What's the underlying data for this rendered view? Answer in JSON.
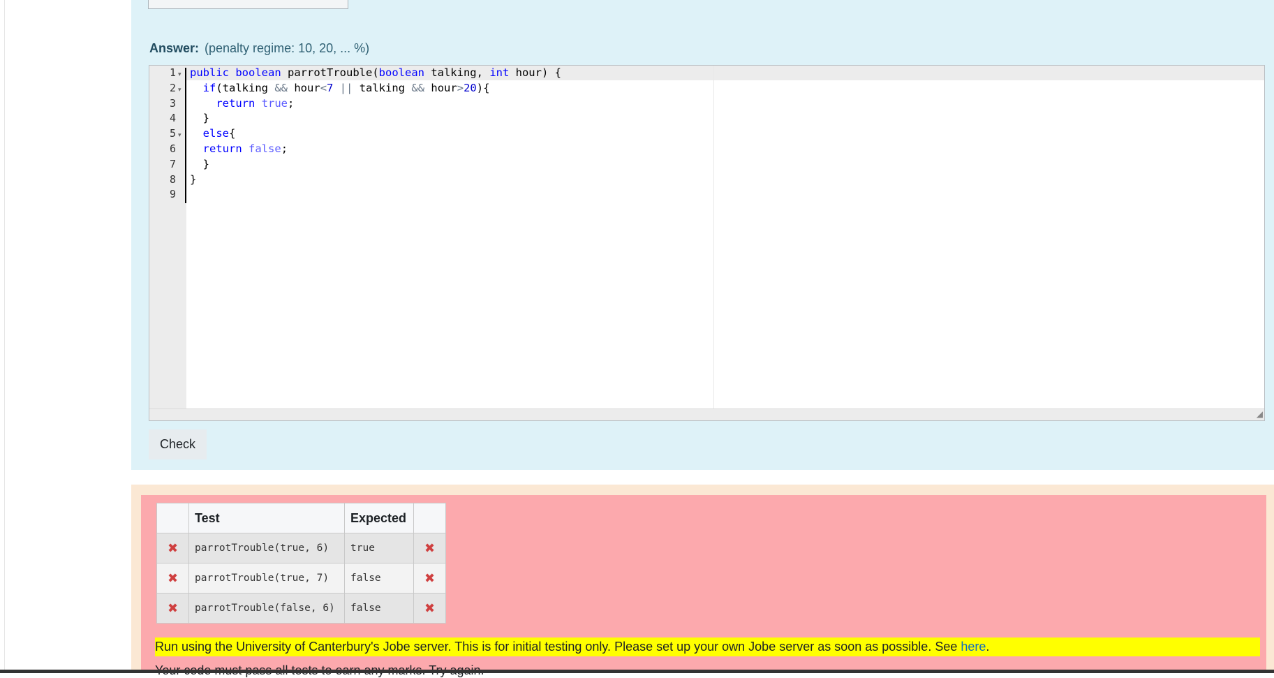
{
  "answer": {
    "label": "Answer:",
    "penalty": "(penalty regime: 10, 20, ... %)"
  },
  "editor": {
    "line_numbers": [
      "1",
      "2",
      "3",
      "4",
      "5",
      "6",
      "7",
      "8",
      "9"
    ],
    "fold_markers": [
      "▾",
      "▾",
      "",
      "",
      "▾",
      "",
      "",
      "",
      ""
    ],
    "language": "Java",
    "code_lines": [
      "public boolean parrotTrouble(boolean talking, int hour) {",
      "  if(talking && hour<7 || talking && hour>20){",
      "    return true;",
      "  }",
      "  else{",
      "  return false;",
      "  }",
      "}",
      ""
    ]
  },
  "check_button": {
    "label": "Check"
  },
  "results": {
    "headers": [
      "",
      "Test",
      "Expected",
      ""
    ],
    "rows": [
      {
        "status": "fail",
        "icon": "✖",
        "test": "parrotTrouble(true, 6)",
        "expected": "true",
        "result_icon": "✖"
      },
      {
        "status": "fail",
        "icon": "✖",
        "test": "parrotTrouble(true, 7)",
        "expected": "false",
        "result_icon": "✖"
      },
      {
        "status": "fail",
        "icon": "✖",
        "test": "parrotTrouble(false, 6)",
        "expected": "false",
        "result_icon": "✖"
      }
    ]
  },
  "jobe_notice": {
    "text": "Run using the University of Canterbury's Jobe server. This is for initial testing only. Please set up your own Jobe server as soon as possible. See ",
    "link": "here",
    "suffix": "."
  },
  "footer_message": "Your code must pass all tests to earn any marks. Try again.",
  "colors": {
    "question_panel": "#def2f8",
    "feedback_outer": "#fbe8d4",
    "feedback_inner": "#fca9ad",
    "notice_highlight": "#ffff00",
    "fail_icon": "#cf3f3f",
    "keyword": "#0000ff"
  }
}
